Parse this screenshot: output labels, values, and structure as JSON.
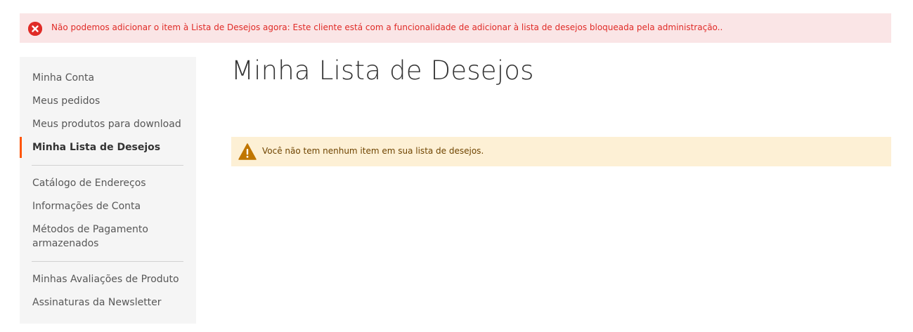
{
  "error_message": {
    "text": "Não podemos adicionar o item à Lista de Desejos agora: Este cliente está com a funcionalidade de adicionar à lista de desejos bloqueada pela administração..",
    "icon": "error-x-icon",
    "color": "#e02b27",
    "background": "#fae5e6"
  },
  "sidebar": {
    "groups": [
      {
        "items": [
          {
            "label": "Minha Conta"
          },
          {
            "label": "Meus pedidos"
          },
          {
            "label": "Meus produtos para download"
          },
          {
            "label": "Minha Lista de Desejos",
            "current": true
          }
        ]
      },
      {
        "items": [
          {
            "label": "Catálogo de Endereços"
          },
          {
            "label": "Informações de Conta"
          },
          {
            "label": "Métodos de Pagamento armazenados"
          }
        ]
      },
      {
        "items": [
          {
            "label": "Minhas Avaliações de Produto"
          },
          {
            "label": "Assinaturas da Newsletter"
          }
        ]
      }
    ],
    "current_indicator_color": "#ff5501"
  },
  "main": {
    "title": "Minha Lista de Desejos",
    "notice": {
      "text": "Você não tem nenhum item em sua lista de desejos.",
      "icon": "warning-icon",
      "background": "#fdf0d5",
      "icon_color": "#c07600"
    }
  }
}
